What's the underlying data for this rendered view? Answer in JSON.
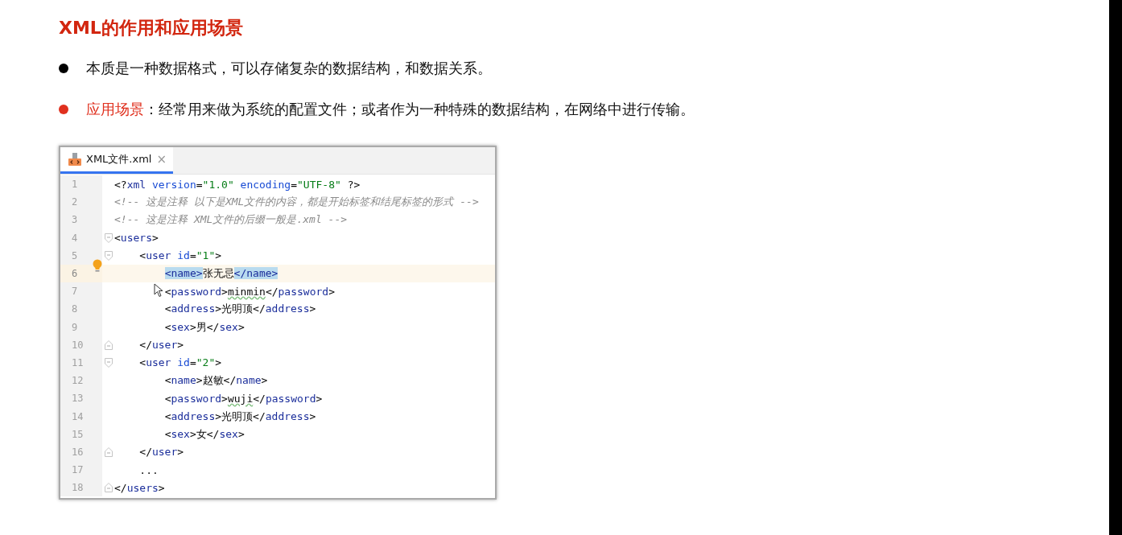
{
  "title": "XML的作用和应用场景",
  "bullets": [
    {
      "color": "#000000",
      "text": "本质是一种数据格式，可以存储复杂的数据结构，和数据关系。"
    },
    {
      "color": "#e0301e",
      "lead": "应用场景",
      "text": "：经常用来做为系统的配置文件；或者作为一种特殊的数据结构，在网络中进行传输。"
    }
  ],
  "editor": {
    "tab": {
      "label": "XML文件.xml",
      "close": "×",
      "selected": true
    },
    "lines": [
      {
        "number": "1",
        "kind": "plain",
        "current": false,
        "tokens": [
          {
            "kind": "punct",
            "text": "<?"
          },
          {
            "kind": "tag",
            "text": "xml "
          },
          {
            "kind": "attr",
            "text": "version"
          },
          {
            "kind": "punct",
            "text": "="
          },
          {
            "kind": "value",
            "text": "\"1.0\" "
          },
          {
            "kind": "attr",
            "text": "encoding"
          },
          {
            "kind": "punct",
            "text": "="
          },
          {
            "kind": "value",
            "text": "\"UTF-8\" "
          },
          {
            "kind": "punct",
            "text": "?>"
          }
        ]
      },
      {
        "number": "2",
        "kind": "plain",
        "current": false,
        "tokens": [
          {
            "kind": "comment",
            "text": "<!-- 这是注释 以下是XML文件的内容，都是开始标签和结尾标签的形式 -->"
          }
        ]
      },
      {
        "number": "3",
        "kind": "plain",
        "current": false,
        "tokens": [
          {
            "kind": "comment",
            "text": "<!-- 这是注释 XML文件的后缀一般是.xml -->"
          }
        ]
      },
      {
        "number": "4",
        "kind": "fold-start",
        "current": false,
        "tokens": [
          {
            "kind": "punct",
            "text": "<"
          },
          {
            "kind": "tag",
            "text": "users"
          },
          {
            "kind": "punct",
            "text": ">"
          }
        ]
      },
      {
        "number": "5",
        "kind": "fold-start",
        "current": false,
        "tokens": [
          {
            "kind": "punct",
            "text": "    <"
          },
          {
            "kind": "tag",
            "text": "user "
          },
          {
            "kind": "attr",
            "text": "id"
          },
          {
            "kind": "punct",
            "text": "="
          },
          {
            "kind": "value",
            "text": "\"1\""
          },
          {
            "kind": "punct",
            "text": ">"
          }
        ]
      },
      {
        "number": "6",
        "kind": "bulb",
        "current": true,
        "tokens": [
          {
            "kind": "match",
            "text": "        <name>"
          },
          {
            "kind": "text",
            "text": "张无忌"
          },
          {
            "kind": "match",
            "text": "</name>"
          }
        ]
      },
      {
        "number": "7",
        "kind": "plain",
        "current": false,
        "tokens": [
          {
            "kind": "punct",
            "text": "        <"
          },
          {
            "kind": "tag",
            "text": "password"
          },
          {
            "kind": "punct",
            "text": ">"
          },
          {
            "kind": "typo",
            "text": "minmin"
          },
          {
            "kind": "punct",
            "text": "</"
          },
          {
            "kind": "tag",
            "text": "password"
          },
          {
            "kind": "punct",
            "text": ">"
          }
        ]
      },
      {
        "number": "8",
        "kind": "plain",
        "current": false,
        "tokens": [
          {
            "kind": "punct",
            "text": "        <"
          },
          {
            "kind": "tag",
            "text": "address"
          },
          {
            "kind": "punct",
            "text": ">"
          },
          {
            "kind": "text",
            "text": "光明顶"
          },
          {
            "kind": "punct",
            "text": "</"
          },
          {
            "kind": "tag",
            "text": "address"
          },
          {
            "kind": "punct",
            "text": ">"
          }
        ]
      },
      {
        "number": "9",
        "kind": "plain",
        "current": false,
        "tokens": [
          {
            "kind": "punct",
            "text": "        <"
          },
          {
            "kind": "tag",
            "text": "sex"
          },
          {
            "kind": "punct",
            "text": ">"
          },
          {
            "kind": "text",
            "text": "男"
          },
          {
            "kind": "punct",
            "text": "</"
          },
          {
            "kind": "tag",
            "text": "sex"
          },
          {
            "kind": "punct",
            "text": ">"
          }
        ]
      },
      {
        "number": "10",
        "kind": "fold-end",
        "current": false,
        "tokens": [
          {
            "kind": "punct",
            "text": "    </"
          },
          {
            "kind": "tag",
            "text": "user"
          },
          {
            "kind": "punct",
            "text": ">"
          }
        ]
      },
      {
        "number": "11",
        "kind": "fold-start",
        "current": false,
        "tokens": [
          {
            "kind": "punct",
            "text": "    <"
          },
          {
            "kind": "tag",
            "text": "user "
          },
          {
            "kind": "attr",
            "text": "id"
          },
          {
            "kind": "punct",
            "text": "="
          },
          {
            "kind": "value",
            "text": "\"2\""
          },
          {
            "kind": "punct",
            "text": ">"
          }
        ]
      },
      {
        "number": "12",
        "kind": "plain",
        "current": false,
        "tokens": [
          {
            "kind": "punct",
            "text": "        <"
          },
          {
            "kind": "tag",
            "text": "name"
          },
          {
            "kind": "punct",
            "text": ">"
          },
          {
            "kind": "text",
            "text": "赵敏"
          },
          {
            "kind": "punct",
            "text": "</"
          },
          {
            "kind": "tag",
            "text": "name"
          },
          {
            "kind": "punct",
            "text": ">"
          }
        ]
      },
      {
        "number": "13",
        "kind": "plain",
        "current": false,
        "tokens": [
          {
            "kind": "punct",
            "text": "        <"
          },
          {
            "kind": "tag",
            "text": "password"
          },
          {
            "kind": "punct",
            "text": ">"
          },
          {
            "kind": "typo",
            "text": "wuji"
          },
          {
            "kind": "punct",
            "text": "</"
          },
          {
            "kind": "tag",
            "text": "password"
          },
          {
            "kind": "punct",
            "text": ">"
          }
        ]
      },
      {
        "number": "14",
        "kind": "plain",
        "current": false,
        "tokens": [
          {
            "kind": "punct",
            "text": "        <"
          },
          {
            "kind": "tag",
            "text": "address"
          },
          {
            "kind": "punct",
            "text": ">"
          },
          {
            "kind": "text",
            "text": "光明顶"
          },
          {
            "kind": "punct",
            "text": "</"
          },
          {
            "kind": "tag",
            "text": "address"
          },
          {
            "kind": "punct",
            "text": ">"
          }
        ]
      },
      {
        "number": "15",
        "kind": "plain",
        "current": false,
        "tokens": [
          {
            "kind": "punct",
            "text": "        <"
          },
          {
            "kind": "tag",
            "text": "sex"
          },
          {
            "kind": "punct",
            "text": ">"
          },
          {
            "kind": "text",
            "text": "女"
          },
          {
            "kind": "punct",
            "text": "</"
          },
          {
            "kind": "tag",
            "text": "sex"
          },
          {
            "kind": "punct",
            "text": ">"
          }
        ]
      },
      {
        "number": "16",
        "kind": "fold-end",
        "current": false,
        "tokens": [
          {
            "kind": "punct",
            "text": "    </"
          },
          {
            "kind": "tag",
            "text": "user"
          },
          {
            "kind": "punct",
            "text": ">"
          }
        ]
      },
      {
        "number": "17",
        "kind": "plain",
        "current": false,
        "tokens": [
          {
            "kind": "text",
            "text": "    ..."
          }
        ]
      },
      {
        "number": "18",
        "kind": "fold-end",
        "current": false,
        "tokens": [
          {
            "kind": "punct",
            "text": "</"
          },
          {
            "kind": "tag",
            "text": "users"
          },
          {
            "kind": "punct",
            "text": ">"
          }
        ]
      }
    ]
  }
}
